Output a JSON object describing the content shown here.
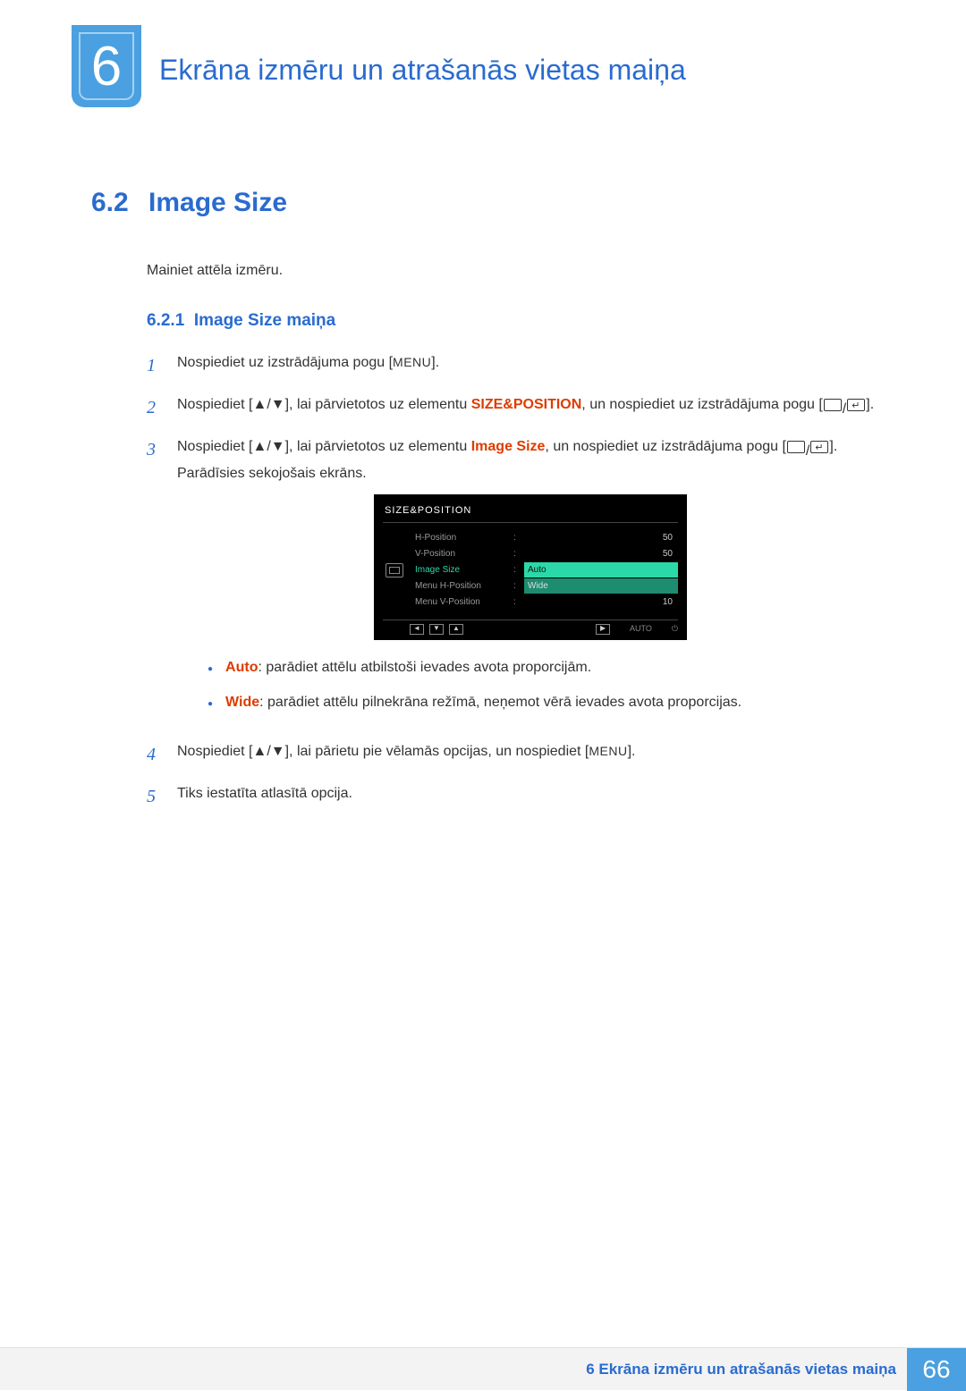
{
  "chapter": {
    "number": "6",
    "title": "Ekrāna izmēru un atrašanās vietas maiņa"
  },
  "section": {
    "number": "6.2",
    "title": "Image Size",
    "intro": "Mainiet attēla izmēru."
  },
  "subsection": {
    "number": "6.2.1",
    "title": "Image Size maiņa"
  },
  "steps": {
    "s1": {
      "num": "1",
      "text_a": "Nospiediet uz izstrādājuma pogu [",
      "menu": "MENU",
      "text_b": "]."
    },
    "s2": {
      "num": "2",
      "text_a": "Nospiediet [▲/▼], lai pārvietotos uz elementu ",
      "hl": "SIZE&POSITION",
      "text_b": ", un nospiediet uz izstrādājuma pogu ["
    },
    "s3": {
      "num": "3",
      "text_a": "Nospiediet [▲/▼], lai pārvietotos uz elementu ",
      "hl": "Image Size",
      "text_b": ", un nospiediet uz izstrādājuma pogu [",
      "text_c": "]. Parādīsies sekojošais ekrāns."
    },
    "s4": {
      "num": "4",
      "text_a": "Nospiediet [▲/▼], lai pārietu pie vēlamās opcijas, un nospiediet [",
      "menu": "MENU",
      "text_b": "]."
    },
    "s5": {
      "num": "5",
      "text": "Tiks iestatīta atlasītā opcija."
    }
  },
  "bullets": {
    "b1": {
      "hl": "Auto",
      "text": ": parādiet attēlu atbilstoši ievades avota proporcijām."
    },
    "b2": {
      "hl": "Wide",
      "text": ": parādiet attēlu pilnekrāna režīmā, neņemot vērā ievades avota proporcijas."
    }
  },
  "osd": {
    "title": "SIZE&POSITION",
    "rows": {
      "r1": {
        "label": "H-Position",
        "val": "50"
      },
      "r2": {
        "label": "V-Position",
        "val": "50"
      },
      "r3": {
        "label": "Image Size",
        "val": "Auto"
      },
      "r3b": {
        "val": "Wide"
      },
      "r4": {
        "label": "Menu H-Position",
        "val": ""
      },
      "r5": {
        "label": "Menu V-Position",
        "val": "10"
      }
    },
    "auto_label": "AUTO"
  },
  "footer": {
    "text": "6 Ekrāna izmēru un atrašanās vietas maiņa",
    "page": "66"
  }
}
